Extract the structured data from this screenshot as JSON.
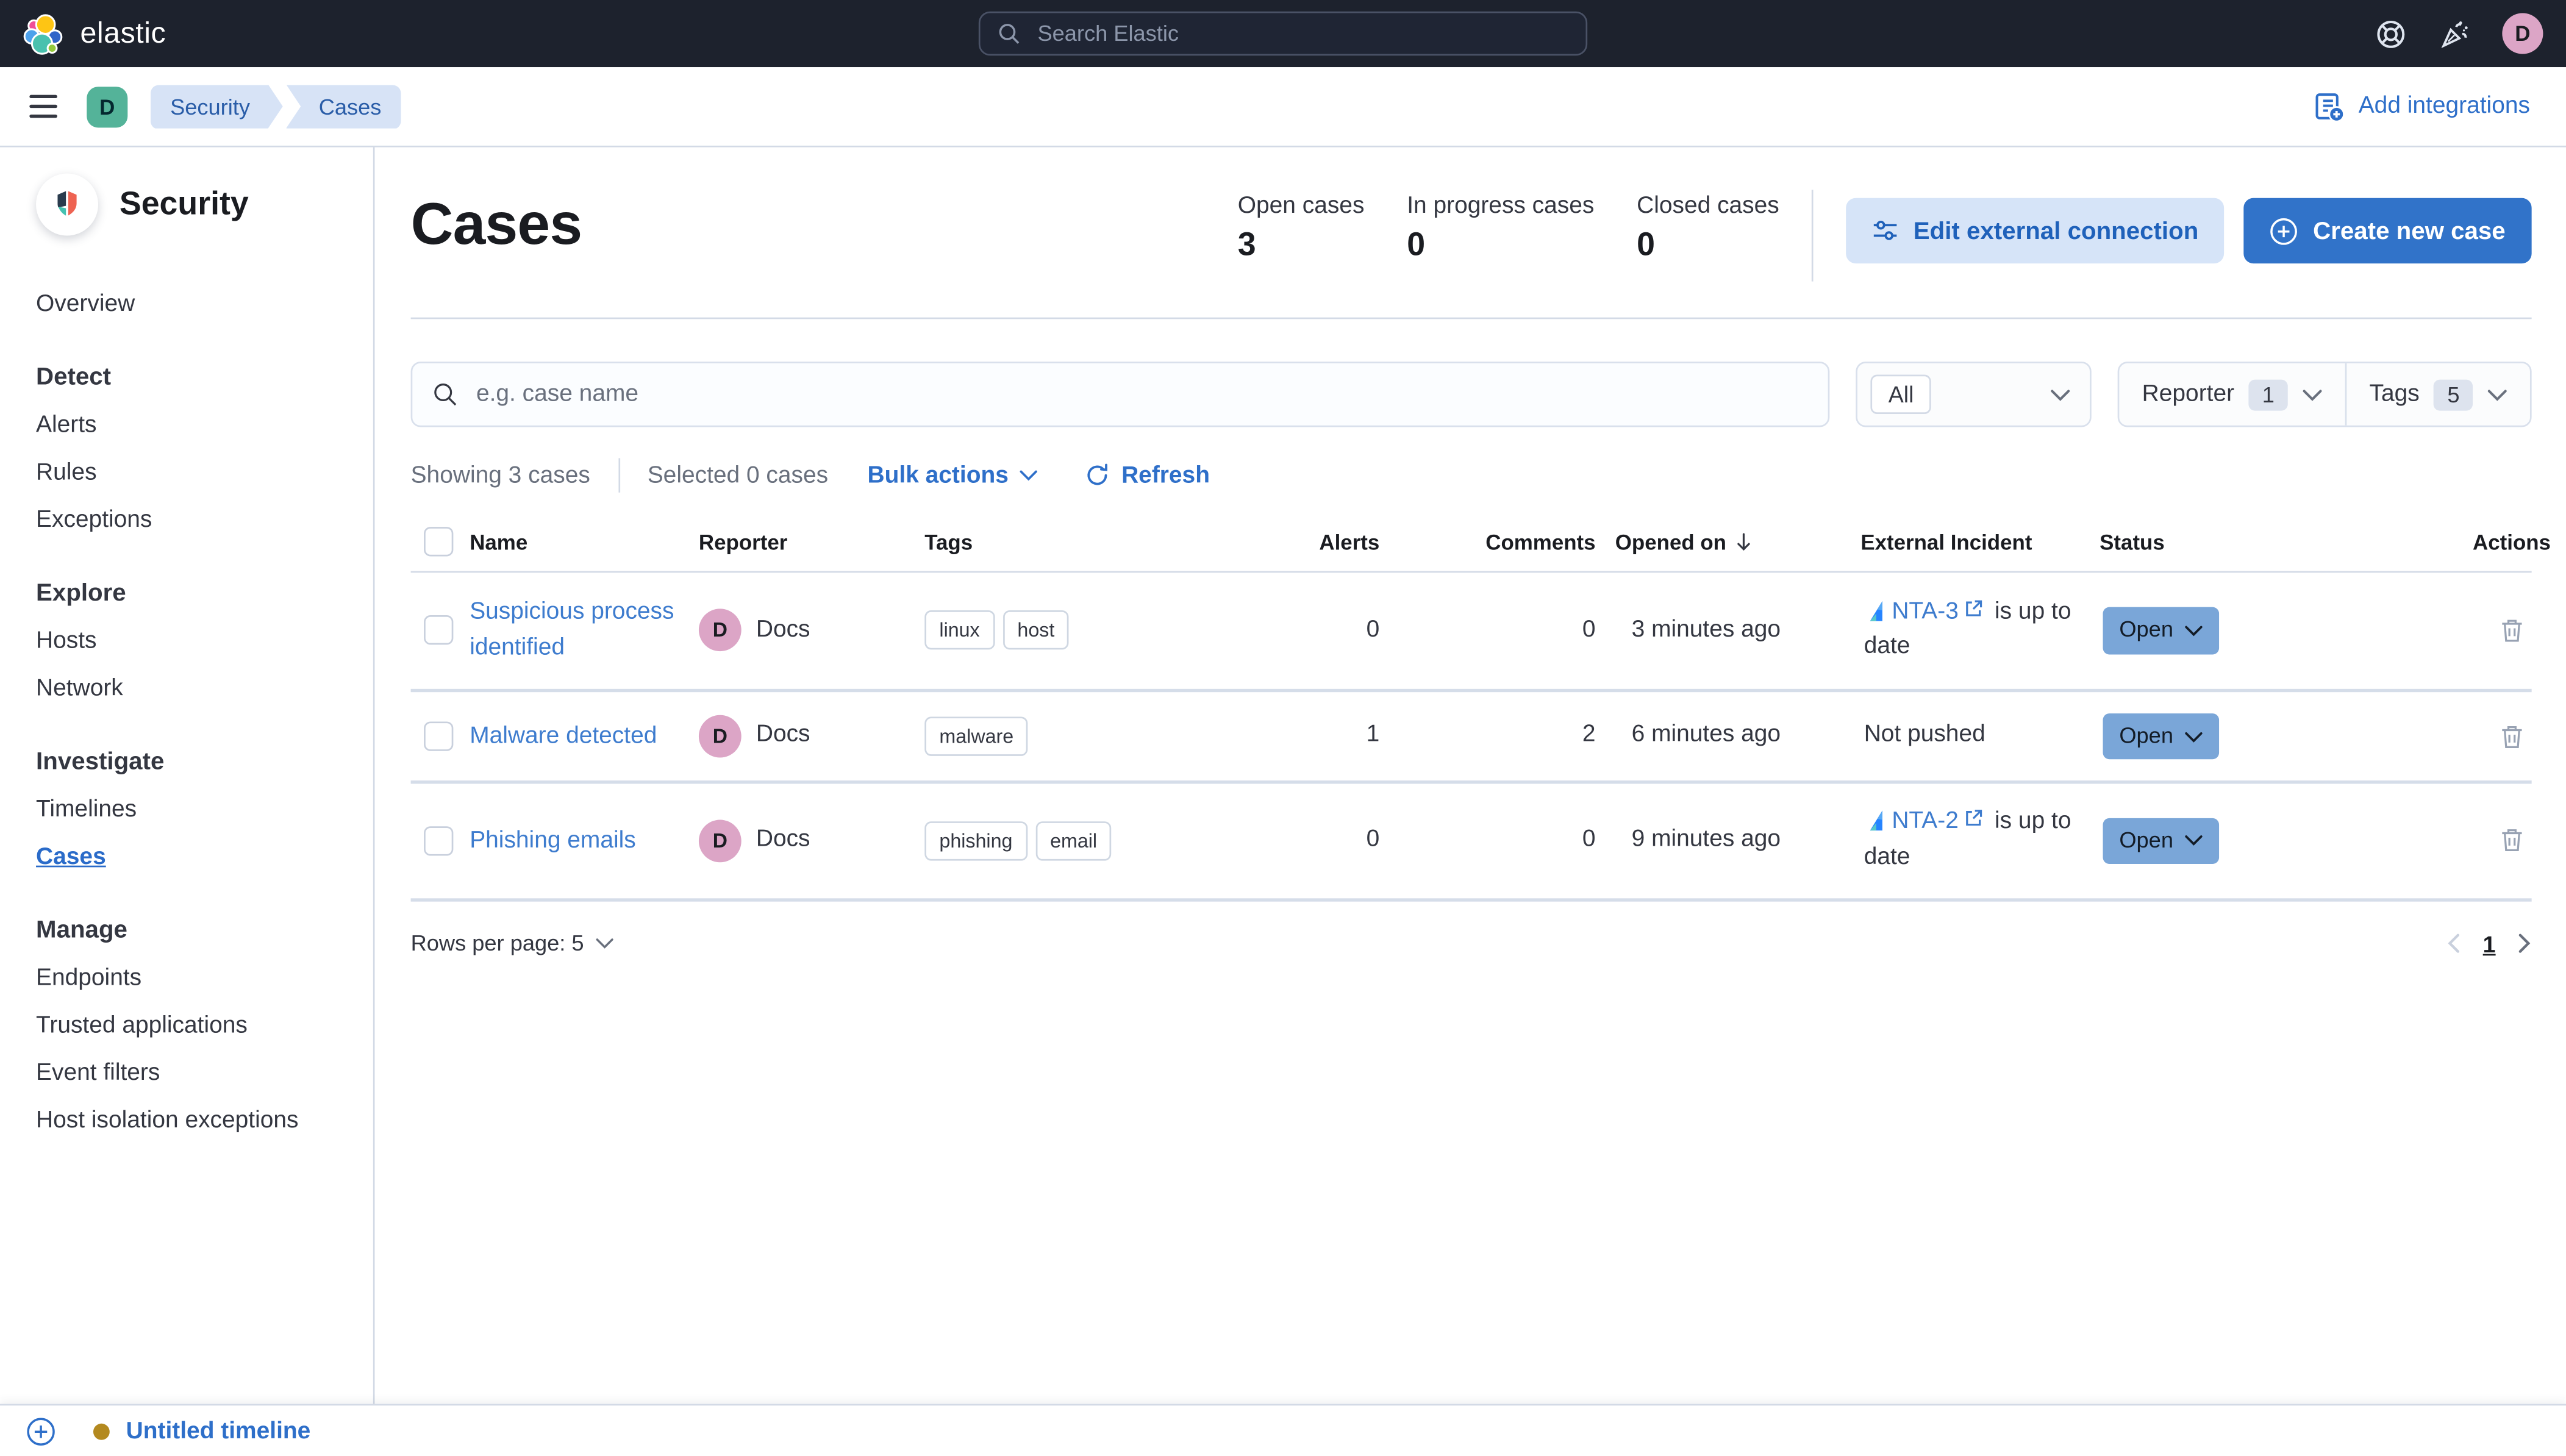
{
  "topbar": {
    "brand": "elastic",
    "search_placeholder": "Search Elastic",
    "avatar_initial": "D"
  },
  "nav": {
    "space_initial": "D",
    "breadcrumbs": [
      "Security",
      "Cases"
    ],
    "add_integrations": "Add integrations"
  },
  "sidebar": {
    "title": "Security",
    "sections": [
      {
        "heading": "",
        "items": [
          {
            "label": "Overview",
            "active": false
          }
        ]
      },
      {
        "heading": "Detect",
        "items": [
          {
            "label": "Alerts",
            "active": false
          },
          {
            "label": "Rules",
            "active": false
          },
          {
            "label": "Exceptions",
            "active": false
          }
        ]
      },
      {
        "heading": "Explore",
        "items": [
          {
            "label": "Hosts",
            "active": false
          },
          {
            "label": "Network",
            "active": false
          }
        ]
      },
      {
        "heading": "Investigate",
        "items": [
          {
            "label": "Timelines",
            "active": false
          },
          {
            "label": "Cases",
            "active": true
          }
        ]
      },
      {
        "heading": "Manage",
        "items": [
          {
            "label": "Endpoints",
            "active": false
          },
          {
            "label": "Trusted applications",
            "active": false
          },
          {
            "label": "Event filters",
            "active": false
          },
          {
            "label": "Host isolation exceptions",
            "active": false
          }
        ]
      }
    ]
  },
  "header": {
    "title": "Cases",
    "stats": [
      {
        "label": "Open cases",
        "value": "3"
      },
      {
        "label": "In progress cases",
        "value": "0"
      },
      {
        "label": "Closed cases",
        "value": "0"
      }
    ],
    "edit_external_label": "Edit external connection",
    "create_case_label": "Create new case"
  },
  "filters": {
    "search_placeholder": "e.g. case name",
    "status_filter": "All",
    "reporter": {
      "label": "Reporter",
      "count": "1"
    },
    "tags": {
      "label": "Tags",
      "count": "5"
    }
  },
  "table_meta": {
    "showing": "Showing 3 cases",
    "selected": "Selected 0 cases",
    "bulk_actions": "Bulk actions",
    "refresh": "Refresh"
  },
  "table": {
    "columns": [
      "Name",
      "Reporter",
      "Tags",
      "Alerts",
      "Comments",
      "Opened on",
      "External Incident",
      "Status",
      "Actions"
    ],
    "sorted_by": "Opened on",
    "rows": [
      {
        "name": "Suspicious process identified",
        "reporter": "Docs",
        "reporter_initial": "D",
        "tags": [
          "linux",
          "host"
        ],
        "alerts": "0",
        "comments": "0",
        "opened": "3 minutes ago",
        "external": {
          "link": "NTA-3",
          "suffix": "is up to date"
        },
        "status": "Open"
      },
      {
        "name": "Malware detected",
        "reporter": "Docs",
        "reporter_initial": "D",
        "tags": [
          "malware"
        ],
        "alerts": "1",
        "comments": "2",
        "opened": "6 minutes ago",
        "external": {
          "text": "Not pushed"
        },
        "status": "Open"
      },
      {
        "name": "Phishing emails",
        "reporter": "Docs",
        "reporter_initial": "D",
        "tags": [
          "phishing",
          "email"
        ],
        "alerts": "0",
        "comments": "0",
        "opened": "9 minutes ago",
        "external": {
          "link": "NTA-2",
          "suffix": "is up to date"
        },
        "status": "Open"
      }
    ]
  },
  "footer": {
    "rows_per_page": "Rows per page: 5",
    "page": "1"
  },
  "timeline_bar": {
    "label": "Untitled timeline"
  },
  "colors": {
    "header_bg": "#1d222d",
    "accent_blue": "#2e6fc9",
    "link_blue": "#3e7cce",
    "primary_button_bg": "#3173c9",
    "secondary_button_bg": "#d6e4f8",
    "breadcrumb_bg": "#d7e3f6",
    "breadcrumb_text": "#2a5da8",
    "space_badge_teal": "#54b399",
    "avatar_pink": "#dca5c6",
    "status_open_bg": "#7aa6d8",
    "timeline_dot_gold": "#b3891f",
    "divider": "#d3dae6"
  }
}
